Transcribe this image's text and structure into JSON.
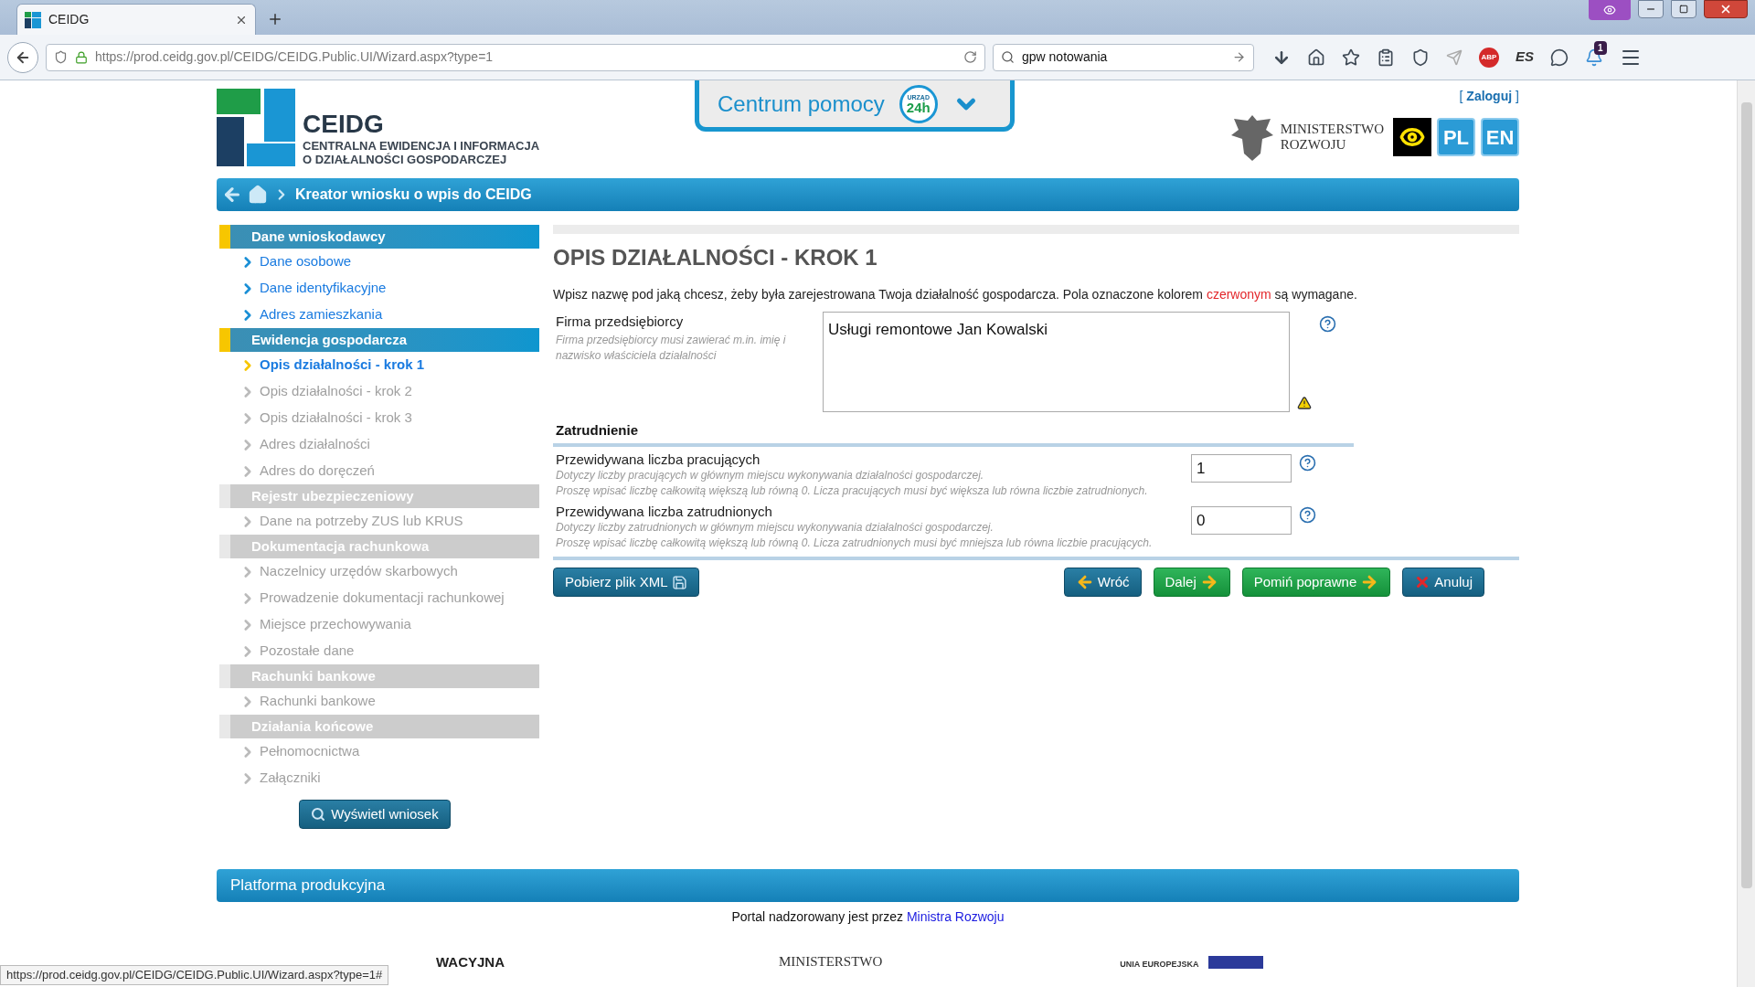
{
  "browser": {
    "tab_title": "CEIDG",
    "address": "https://prod.ceidg.gov.pl/CEIDG/CEIDG.Public.UI/Wizard.aspx?type=1",
    "search_value": "gpw notowania",
    "adblock_label": "ABP",
    "extension_label": "ES",
    "notification_count": "1",
    "status_url": "https://prod.ceidg.gov.pl/CEIDG/CEIDG.Public.UI/Wizard.aspx?type=1#"
  },
  "header": {
    "logo_title": "CEIDG",
    "logo_subtitle": [
      "CENTRALNA EWIDENCJA I INFORMACJA",
      "O DZIAŁALNOŚCI GOSPODARCZEJ"
    ],
    "help": {
      "label": "Centrum pomocy",
      "badge_top": "URZĄD",
      "badge_main": "24h"
    },
    "login": {
      "open": "[",
      "label": "Zaloguj",
      "close": "]"
    },
    "ministry": [
      "MINISTERSTWO",
      "ROZWOJU"
    ],
    "languages": [
      {
        "label": "PL"
      },
      {
        "label": "EN"
      }
    ]
  },
  "breadcrumb": {
    "title": "Kreator wniosku o wpis do CEIDG"
  },
  "sidebar": {
    "sections": [
      {
        "title": "Dane wnioskodawcy",
        "disabled": false,
        "items": [
          {
            "label": "Dane osobowe",
            "selected": false,
            "disabled": false
          },
          {
            "label": "Dane identyfikacyjne",
            "selected": false,
            "disabled": false
          },
          {
            "label": "Adres zamieszkania",
            "selected": false,
            "disabled": false
          }
        ]
      },
      {
        "title": "Ewidencja gospodarcza",
        "disabled": false,
        "items": [
          {
            "label": "Opis działalności - krok 1",
            "selected": true,
            "disabled": false
          },
          {
            "label": "Opis działalności - krok 2",
            "selected": false,
            "disabled": true
          },
          {
            "label": "Opis działalności - krok 3",
            "selected": false,
            "disabled": true
          },
          {
            "label": "Adres działalności",
            "selected": false,
            "disabled": true
          },
          {
            "label": "Adres do doręczeń",
            "selected": false,
            "disabled": true
          }
        ]
      },
      {
        "title": "Rejestr ubezpieczeniowy",
        "disabled": true,
        "items": [
          {
            "label": "Dane na potrzeby ZUS lub KRUS",
            "selected": false,
            "disabled": true
          }
        ]
      },
      {
        "title": "Dokumentacja rachunkowa",
        "disabled": true,
        "items": [
          {
            "label": "Naczelnicy urzędów skarbowych",
            "selected": false,
            "disabled": true
          },
          {
            "label": "Prowadzenie dokumentacji rachunkowej",
            "selected": false,
            "disabled": true
          },
          {
            "label": "Miejsce przechowywania",
            "selected": false,
            "disabled": true
          },
          {
            "label": "Pozostałe dane",
            "selected": false,
            "disabled": true
          }
        ]
      },
      {
        "title": "Rachunki bankowe",
        "disabled": true,
        "items": [
          {
            "label": "Rachunki bankowe",
            "selected": false,
            "disabled": true
          }
        ]
      },
      {
        "title": "Działania końcowe",
        "disabled": true,
        "items": [
          {
            "label": "Pełnomocnictwa",
            "selected": false,
            "disabled": true
          },
          {
            "label": "Załączniki",
            "selected": false,
            "disabled": true
          }
        ]
      }
    ],
    "button": "Wyświetl wniosek"
  },
  "main": {
    "title": "OPIS DZIAŁALNOŚCI - KROK 1",
    "intro_before": "Wpisz nazwę pod jaką chcesz, żeby była zarejestrowana Twoja działalność gospodarcza. Pola oznaczone kolorem",
    "intro_red": "czerwonym",
    "intro_after": "są wymagane.",
    "company": {
      "label": "Firma przedsiębiorcy",
      "hint": "Firma przedsiębiorcy musi zawierać m.in. imię i nazwisko właściciela działalności",
      "value": "Usługi remontowe Jan Kowalski"
    },
    "section_title": "Zatrudnienie",
    "number_fields": [
      {
        "label": "Przewidywana liczba pracujących",
        "hints": [
          "Dotyczy liczby pracujących w głównym miejscu wykonywania działalności gospodarczej.",
          "Proszę wpisać liczbę całkowitą większą lub równą 0. Licza pracujących musi być większa lub równa liczbie zatrudnionych."
        ],
        "value": "1"
      },
      {
        "label": "Przewidywana liczba zatrudnionych",
        "hints": [
          "Dotyczy liczby zatrudnionych w głównym miejscu wykonywania działalności gospodarczej.",
          "Proszę wpisać liczbę całkowitą większą lub równą 0. Licza zatrudnionych musi być mniejsza lub równa liczbie pracujących."
        ],
        "value": "0"
      }
    ],
    "buttons": [
      {
        "label": "Pobierz plik XML",
        "kind": "xml"
      },
      {
        "label": "Wróć",
        "kind": "back"
      },
      {
        "label": "Dalej",
        "kind": "next"
      },
      {
        "label": "Pomiń poprawne",
        "kind": "skip"
      },
      {
        "label": "Anuluj",
        "kind": "cancel"
      }
    ]
  },
  "footer": {
    "bar": "Platforma produkcyjna",
    "text": "Portal nadzorowany jest przez",
    "link": "Ministra Rozwoju",
    "logos": [
      "WACYJNA",
      "MINISTERSTWO",
      "UNIA EUROPEJSKA"
    ]
  }
}
